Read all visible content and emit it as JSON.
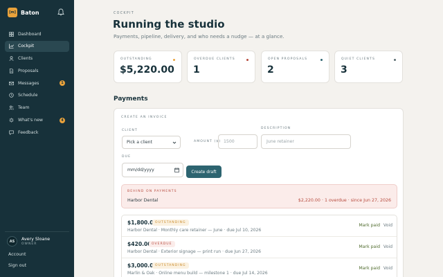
{
  "app": {
    "logo_text": "[m]",
    "name": "Baton",
    "bell_icon": "bell-icon"
  },
  "sidebar": {
    "items": [
      {
        "label": "Dashboard",
        "icon": "grid-icon",
        "active": false
      },
      {
        "label": "Cockpit",
        "icon": "chart-icon",
        "active": true
      },
      {
        "label": "Clients",
        "icon": "person-icon",
        "active": false
      },
      {
        "label": "Proposals",
        "icon": "document-icon",
        "active": false
      },
      {
        "label": "Messages",
        "icon": "mail-icon",
        "active": false,
        "badge": "1"
      },
      {
        "label": "Schedule",
        "icon": "clock-icon",
        "active": false
      },
      {
        "label": "Team",
        "icon": "team-icon",
        "active": false
      },
      {
        "label": "What's new",
        "icon": "sparkle-icon",
        "active": false,
        "badge": "4"
      },
      {
        "label": "Feedback",
        "icon": "chat-icon",
        "active": false
      }
    ],
    "user": {
      "initials": "AS",
      "name": "Avery Sloane",
      "role": "OWNER"
    },
    "account_label": "Account",
    "signout_label": "Sign out"
  },
  "header": {
    "eyebrow": "COCKPIT",
    "title": "Running the studio",
    "subtitle": "Payments, pipeline, delivery, and who needs a nudge — at a glance."
  },
  "stats": [
    {
      "label": "OUTSTANDING",
      "value": "$5,220.00",
      "dot_color": "#e9a23b"
    },
    {
      "label": "OVERDUE CLIENTS",
      "value": "1",
      "dot_color": "#b6493c"
    },
    {
      "label": "OPEN PROPOSALS",
      "value": "2",
      "dot_color": "#2d6470"
    },
    {
      "label": "QUIET CLIENTS",
      "value": "3",
      "dot_color": "#5a6b70"
    }
  ],
  "payments": {
    "section_title": "Payments",
    "form": {
      "eyebrow": "CREATE AN INVOICE",
      "client_label": "CLIENT",
      "client_value": "Pick a client",
      "amount_label": "AMOUNT ($)",
      "amount_placeholder": "1500",
      "description_label": "DESCRIPTION",
      "description_placeholder": "June retainer",
      "due_label": "DUE",
      "due_value": "mm/dd/yyyy",
      "submit_label": "Create draft"
    },
    "alert": {
      "label": "BEHIND ON PAYMENTS",
      "client": "Harbor Dental",
      "summary": "$2,220.00 · 1 overdue · since Jun 27, 2026"
    },
    "invoices": [
      {
        "amount": "$1,800.00",
        "status": "OUTSTANDING",
        "status_kind": "outstanding",
        "desc": "Harbor Dental · Monthly care retainer — June · due Jul 10, 2026",
        "mark_label": "Mark paid",
        "void_label": "Void"
      },
      {
        "amount": "$420.00",
        "status": "OVERDUE",
        "status_kind": "overdue",
        "desc": "Harbor Dental · Exterior signage — print run · due Jun 27, 2026",
        "mark_label": "Mark paid",
        "void_label": "Void"
      },
      {
        "amount": "$3,000.00",
        "status": "OUTSTANDING",
        "status_kind": "outstanding",
        "desc": "Marlin & Oak · Online menu build — milestone 1 · due Jul 14, 2026",
        "mark_label": "Mark paid",
        "void_label": "Void"
      }
    ]
  }
}
